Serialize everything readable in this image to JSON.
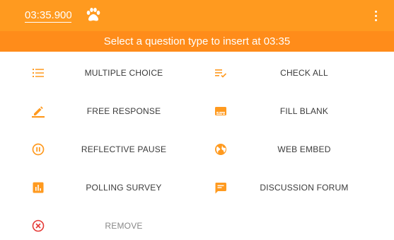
{
  "header": {
    "timestamp_value": "03:35.900",
    "paw_icon": "paw-icon",
    "menu_icon": "more-vertical-icon"
  },
  "banner": {
    "text": "Select a question type to insert at 03:35"
  },
  "options": [
    {
      "label": "MULTIPLE CHOICE",
      "icon": "list-icon"
    },
    {
      "label": "CHECK ALL",
      "icon": "playlist-check-icon"
    },
    {
      "label": "FREE RESPONSE",
      "icon": "edit-icon"
    },
    {
      "label": "FILL BLANK",
      "icon": "subtitles-icon"
    },
    {
      "label": "REFLECTIVE PAUSE",
      "icon": "pause-circle-icon"
    },
    {
      "label": "WEB EMBED",
      "icon": "globe-icon"
    },
    {
      "label": "POLLING SURVEY",
      "icon": "poll-icon"
    },
    {
      "label": "DISCUSSION FORUM",
      "icon": "chat-icon"
    },
    {
      "label": "REMOVE",
      "icon": "cancel-icon"
    }
  ],
  "colors": {
    "accent": "#ff9a1f",
    "banner": "#ff8c1a",
    "text": "#3b3b3b",
    "remove": "#e53935"
  }
}
